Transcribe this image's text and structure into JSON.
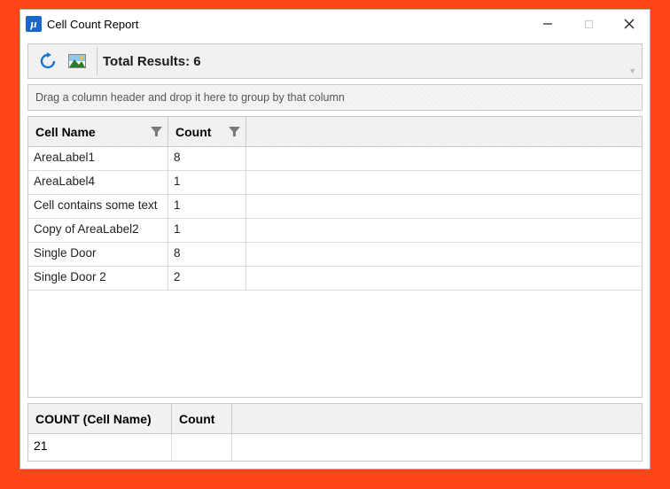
{
  "window": {
    "title": "Cell Count Report"
  },
  "toolbar": {
    "total_label": "Total Results:",
    "total_value": "6"
  },
  "group_hint": "Drag a column header and drop it here to group by that column",
  "columns": {
    "name": "Cell Name",
    "count": "Count"
  },
  "rows": [
    {
      "name": "AreaLabel1",
      "count": "8"
    },
    {
      "name": "AreaLabel4",
      "count": "1"
    },
    {
      "name": "Cell contains some text",
      "count": "1"
    },
    {
      "name": "Copy of AreaLabel2",
      "count": "1"
    },
    {
      "name": "Single Door",
      "count": "8"
    },
    {
      "name": "Single Door 2",
      "count": "2"
    }
  ],
  "summary": {
    "col_name": "COUNT (Cell Name)",
    "col_count": "Count",
    "value": "21"
  }
}
